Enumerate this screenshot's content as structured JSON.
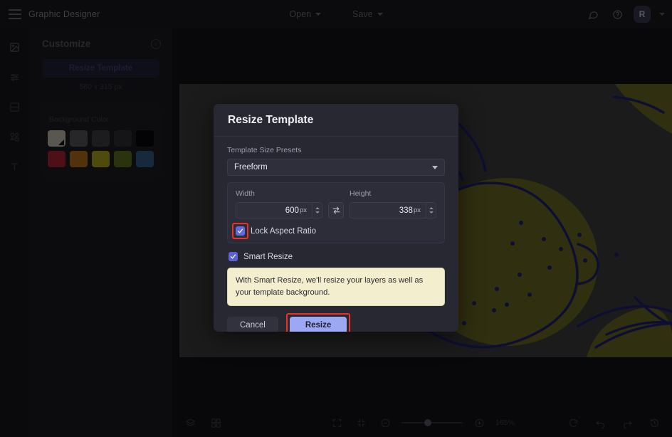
{
  "app": {
    "title": "Graphic Designer",
    "menu_icon": "hamburger-icon"
  },
  "topbar": {
    "open_label": "Open",
    "save_label": "Save",
    "comment_icon": "comment-icon",
    "help_icon": "help-circle-icon",
    "avatar_initial": "R"
  },
  "rail": {
    "items": [
      {
        "icon": "image-icon",
        "name": "images"
      },
      {
        "icon": "sliders-icon",
        "name": "adjustments"
      },
      {
        "icon": "template-icon",
        "name": "templates"
      },
      {
        "icon": "shapes-icon",
        "name": "elements"
      },
      {
        "icon": "text-icon",
        "name": "text"
      }
    ]
  },
  "sidebar": {
    "title": "Customize",
    "info_icon": "info-icon",
    "resize_template_label": "Resize Template",
    "template_dimensions": "560 x 315 px",
    "background_color_label": "Background Color",
    "swatches_row1": [
      "#cfc9b4",
      "#565659",
      "#3c3c3c",
      "#2b2b2b",
      "#000000"
    ],
    "swatches_row2": [
      "#b21f2d",
      "#b77412",
      "#b5ab12",
      "#5d7317",
      "#2c6186"
    ],
    "selected_swatch_index": 0
  },
  "canvas": {
    "background_color": "#3a3a35",
    "artwork_ink": "#1b1b6e",
    "artwork_fill": "#6b6a1a",
    "description": "lemon illustration"
  },
  "bottombar": {
    "layers_icon": "layers-icon",
    "grid_icon": "grid-icon",
    "fit_icon": "fit-screen-icon",
    "fullscreen_icon": "collapse-icon",
    "zoom_out_icon": "zoom-out-icon",
    "zoom_in_icon": "zoom-in-icon",
    "zoom_level": "165%",
    "reset_icon": "reset-icon",
    "undo_icon": "undo-icon",
    "redo_icon": "redo-icon",
    "history_icon": "history-icon"
  },
  "modal": {
    "title": "Resize Template",
    "presets_label": "Template Size Presets",
    "preset_selected": "Freeform",
    "preset_options": [
      "Freeform"
    ],
    "width_label": "Width",
    "width_value": "600",
    "width_unit": "px",
    "height_label": "Height",
    "height_value": "338",
    "height_unit": "px",
    "swap_icon": "swap-arrows-icon",
    "lock_aspect_label": "Lock Aspect Ratio",
    "lock_aspect_checked": true,
    "smart_resize_label": "Smart Resize",
    "smart_resize_checked": true,
    "notice_text": "With Smart Resize, we'll resize your layers as well as your template background.",
    "cancel_label": "Cancel",
    "resize_label": "Resize",
    "highlight_color": "#e8322a",
    "primary_button_color": "#9da8f5",
    "checkbox_color": "#6169e8"
  }
}
